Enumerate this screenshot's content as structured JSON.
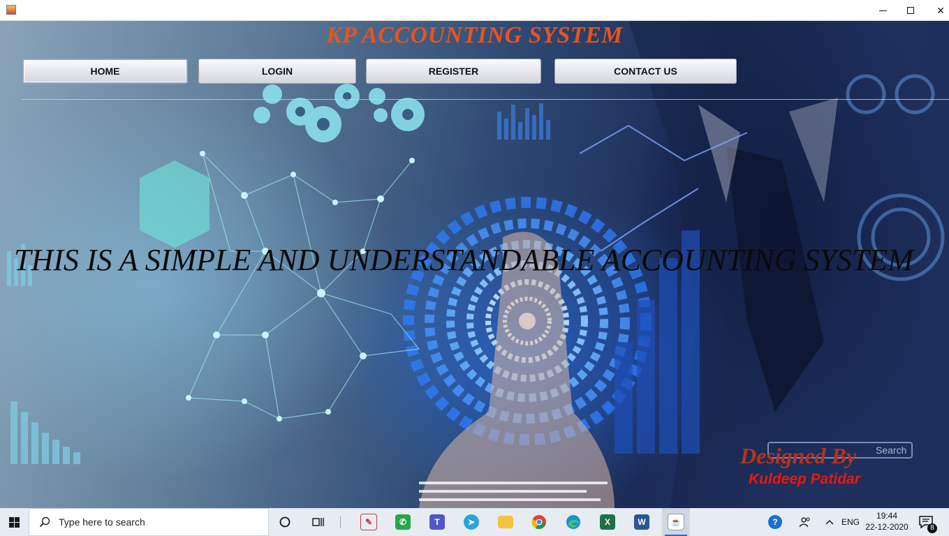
{
  "window": {
    "title": "",
    "controls": {
      "minimize": "minimize",
      "maximize": "maximize",
      "close": "✕"
    }
  },
  "app": {
    "title": "KP ACCOUNTING SYSTEM",
    "nav": [
      {
        "label": "HOME",
        "active": true
      },
      {
        "label": "LOGIN",
        "active": false
      },
      {
        "label": "REGISTER",
        "active": false
      },
      {
        "label": "CONTACT US",
        "active": false
      }
    ],
    "marquee_text": "THIS IS A SIMPLE AND UNDERSTANDABLE ACCOUNTING SYSTEM",
    "designed_by": "Designed By",
    "designer_name": "Kuldeep Patidar",
    "colors": {
      "title": "#e8531f",
      "designed_by": "#b8321b",
      "designer": "#e8180f"
    }
  },
  "taskbar": {
    "search_placeholder": "Type here to search",
    "pinned": [
      {
        "icon": "paint-icon",
        "running": false
      },
      {
        "icon": "whatsapp-icon",
        "running": false
      },
      {
        "icon": "teams-icon",
        "running": false
      },
      {
        "icon": "telegram-icon",
        "running": false
      },
      {
        "icon": "file-explorer-icon",
        "running": false
      },
      {
        "icon": "chrome-icon",
        "running": false
      },
      {
        "icon": "edge-icon",
        "running": false
      },
      {
        "icon": "excel-icon",
        "running": false
      },
      {
        "icon": "word-icon",
        "running": false
      },
      {
        "icon": "java-icon",
        "running": true
      }
    ],
    "language": "ENG",
    "time": "19:44",
    "date": "22-12-2020",
    "notification_count": "8"
  }
}
